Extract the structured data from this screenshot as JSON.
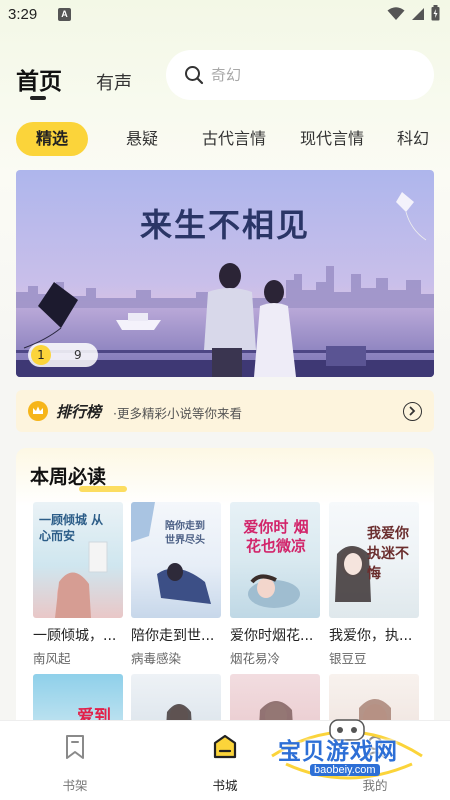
{
  "status_bar": {
    "time": "3:29",
    "notification_icon": "a-app-icon",
    "icons": [
      "wifi-icon",
      "signal-icon",
      "battery-icon"
    ]
  },
  "header": {
    "tabs": [
      {
        "label": "首页",
        "active": true
      },
      {
        "label": "有声",
        "active": false
      }
    ],
    "search": {
      "placeholder": "奇幻",
      "icon": "search-icon"
    }
  },
  "categories": [
    {
      "label": "精选",
      "active": true
    },
    {
      "label": "悬疑",
      "active": false
    },
    {
      "label": "古代言情",
      "active": false
    },
    {
      "label": "现代言情",
      "active": false
    },
    {
      "label": "科幻",
      "active": false
    }
  ],
  "banner": {
    "title": "来生不相见",
    "pager": {
      "current": "1",
      "total": "9"
    }
  },
  "ranking": {
    "title": "排行榜",
    "subtitle": "·更多精彩小说等你来看"
  },
  "weekly": {
    "title": "本周必读",
    "books": [
      {
        "title": "一顾倾城，...",
        "author": "南风起",
        "cover_text": "一顾倾城 从心而安"
      },
      {
        "title": "陪你走到世...",
        "author": "病毒感染",
        "cover_text": "陪你走到 世界尽头"
      },
      {
        "title": "爱你时烟花...",
        "author": "烟花易冷",
        "cover_text": "爱你时 烟花也微凉"
      },
      {
        "title": "我爱你，执...",
        "author": "银豆豆",
        "cover_text": "我爱你 执迷不悔"
      }
    ],
    "row2_cover_text": "爱到"
  },
  "bottom_nav": {
    "items": [
      {
        "label": "书架",
        "icon": "bookmark-icon",
        "active": false
      },
      {
        "label": "书城",
        "icon": "store-icon",
        "active": true
      },
      {
        "label": "我的",
        "icon": "profile-icon",
        "active": false
      }
    ]
  },
  "watermark": {
    "text": "宝贝游戏网",
    "url": "baobeiy.com"
  },
  "colors": {
    "accent": "#fbd43a",
    "banner_title": "#2a3566",
    "watermark": "#2d6fd6"
  }
}
